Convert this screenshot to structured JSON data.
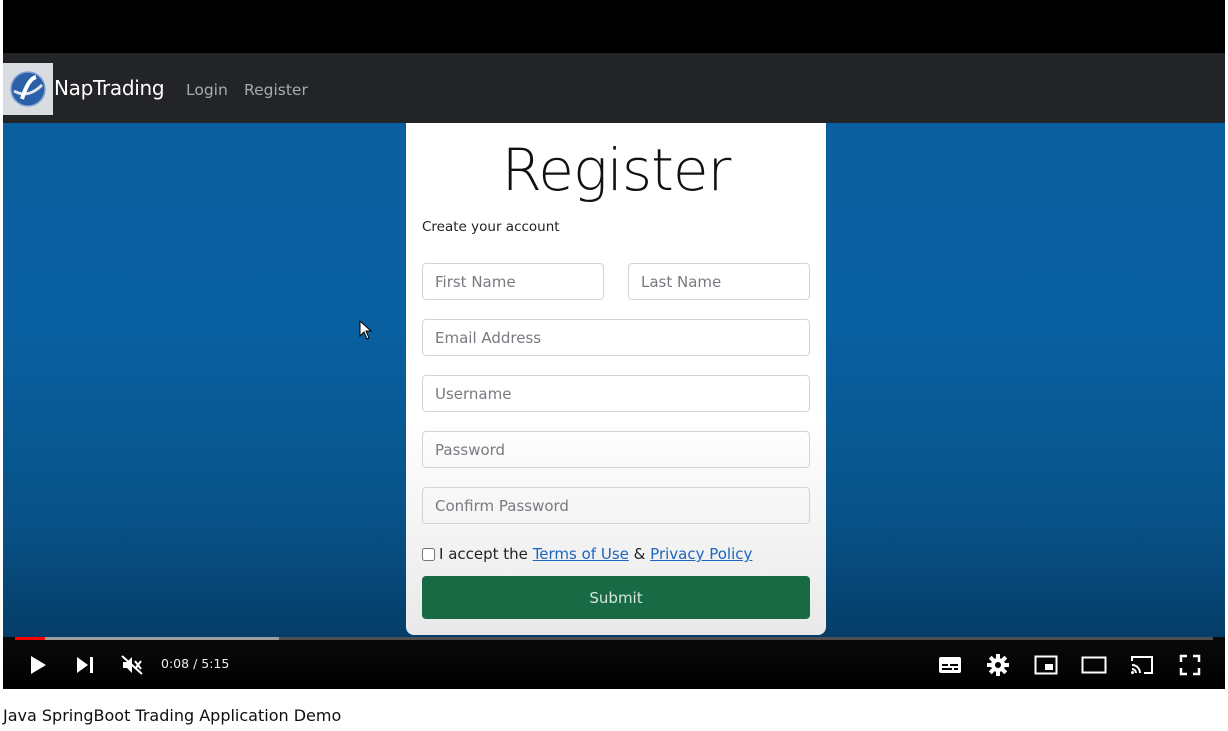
{
  "app": {
    "brand": "NapTrading",
    "nav": [
      "Login",
      "Register"
    ]
  },
  "form": {
    "title": "Register",
    "subtitle": "Create your account",
    "placeholders": {
      "first_name": "First Name",
      "last_name": "Last Name",
      "email": "Email Address",
      "username": "Username",
      "password": "Password",
      "confirm_password": "Confirm Password"
    },
    "consent": {
      "prefix": "I accept the",
      "terms": "Terms of Use",
      "amp": "&",
      "privacy": "Privacy Policy"
    },
    "submit": "Submit"
  },
  "player": {
    "current_time": "0:08",
    "separator": "/",
    "duration": "5:15",
    "played_fraction": 0.025,
    "buffered_fraction": 0.22,
    "icons": [
      "play-icon",
      "next-icon",
      "muted-icon",
      "subtitles-icon",
      "settings-icon",
      "miniplayer-icon",
      "theater-icon",
      "cast-icon",
      "fullscreen-icon"
    ]
  },
  "video": {
    "title": "Java SpringBoot Trading Application Demo"
  },
  "colors": {
    "navbar": "#222427",
    "background": "#0961a2",
    "submit": "#186a45",
    "link": "#1a66c0",
    "progress_played": "#ff0000"
  }
}
